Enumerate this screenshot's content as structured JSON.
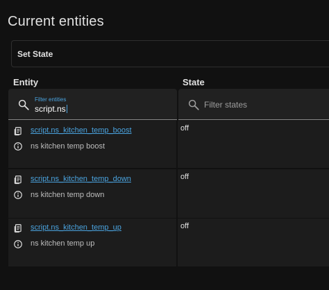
{
  "page": {
    "title": "Current entities"
  },
  "set_state": {
    "label": "Set State"
  },
  "table": {
    "headers": {
      "entity": "Entity",
      "state": "State"
    },
    "entity_filter": {
      "label": "Filter entities",
      "value": "script.ns"
    },
    "state_filter": {
      "placeholder": "Filter states"
    },
    "rows": [
      {
        "entity_id": "script.ns_kitchen_temp_boost",
        "friendly_name": "ns kitchen temp boost",
        "state": "off"
      },
      {
        "entity_id": "script.ns_kitchen_temp_down",
        "friendly_name": "ns kitchen temp down",
        "state": "off"
      },
      {
        "entity_id": "script.ns_kitchen_temp_up",
        "friendly_name": "ns kitchen temp up",
        "state": "off"
      }
    ]
  },
  "icons": {
    "search": "magnify-icon",
    "entity": "script-text-icon",
    "attributes": "information-outline-icon"
  },
  "colors": {
    "background": "#111111",
    "cell": "#1c1c1c",
    "filter": "#212121",
    "link": "#4aa3df",
    "text": "#e1e1e1"
  }
}
